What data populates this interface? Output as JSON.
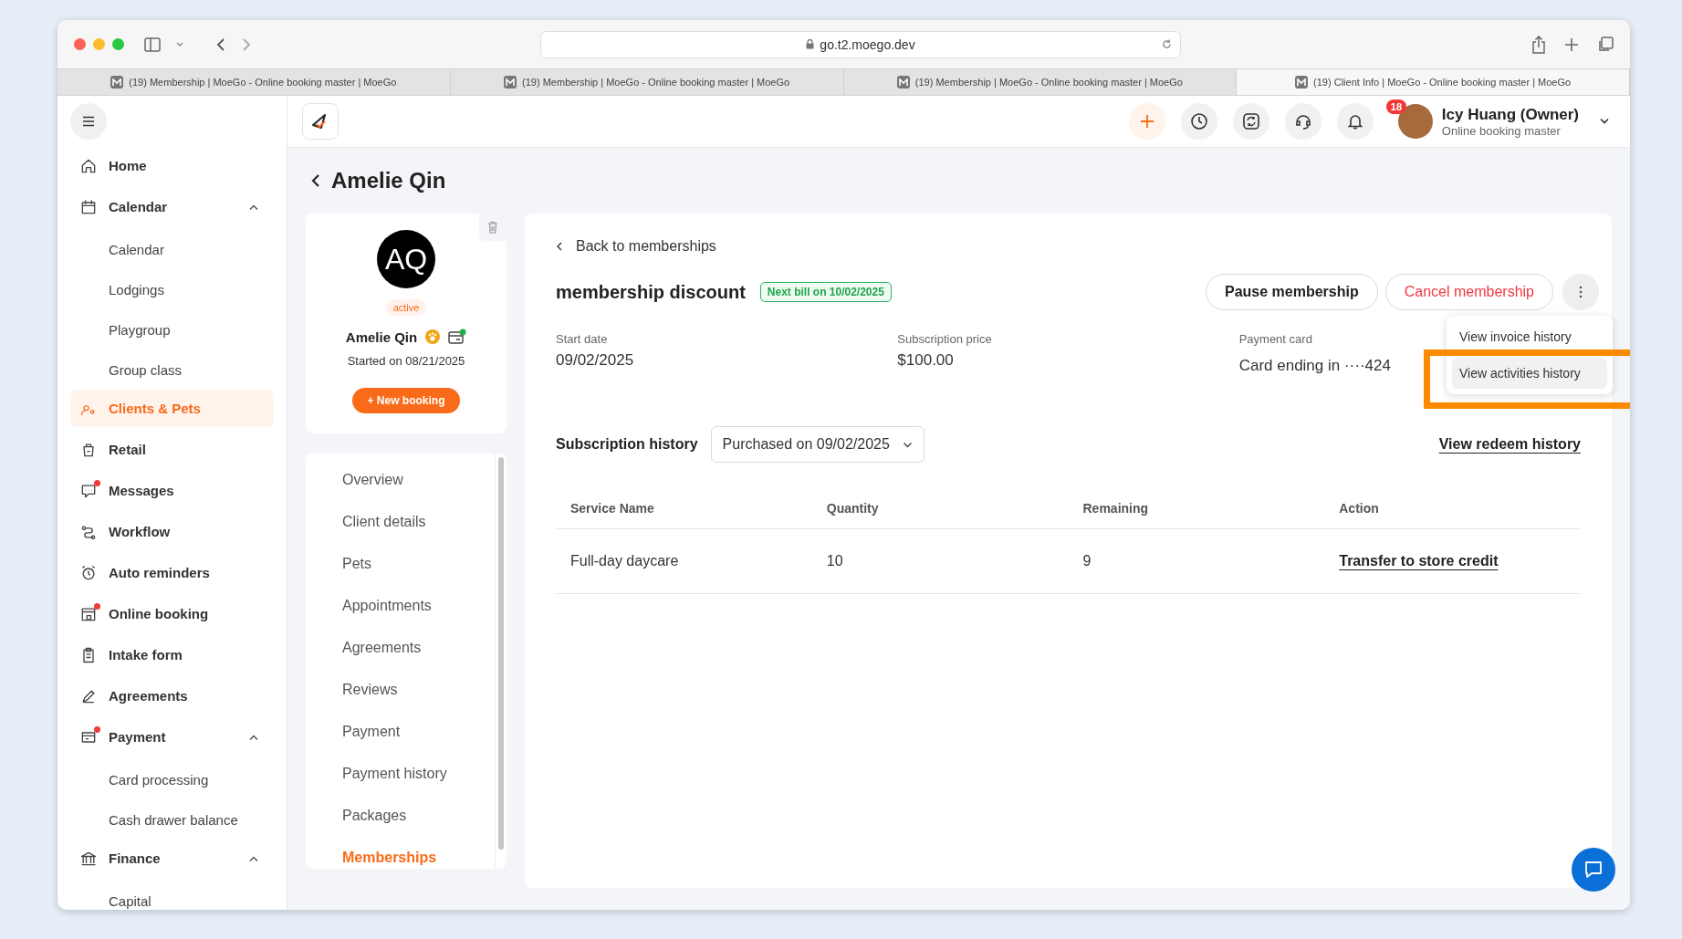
{
  "browser": {
    "url": "go.t2.moego.dev",
    "tabs": [
      {
        "title": "(19) Membership | MoeGo - Online booking master | MoeGo",
        "selected": false
      },
      {
        "title": "(19) Membership | MoeGo - Online booking master | MoeGo",
        "selected": false
      },
      {
        "title": "(19) Membership | MoeGo - Online booking master | MoeGo",
        "selected": false
      },
      {
        "title": "(19) Client Info | MoeGo - Online booking master | MoeGo",
        "selected": true
      }
    ]
  },
  "sidebar": {
    "items": [
      {
        "label": "Home",
        "selected": false,
        "notification": false
      },
      {
        "label": "Calendar",
        "selected": false,
        "notification": false,
        "expanded": true,
        "children": [
          {
            "label": "Calendar",
            "selected": false
          },
          {
            "label": "Lodgings",
            "selected": false
          },
          {
            "label": "Playgroup",
            "selected": false
          },
          {
            "label": "Group class",
            "selected": false
          }
        ]
      },
      {
        "label": "Clients & Pets",
        "selected": true,
        "notification": false
      },
      {
        "label": "Retail",
        "selected": false,
        "notification": false
      },
      {
        "label": "Messages",
        "selected": false,
        "notification": true
      },
      {
        "label": "Workflow",
        "selected": false,
        "notification": false
      },
      {
        "label": "Auto reminders",
        "selected": false,
        "notification": false
      },
      {
        "label": "Online booking",
        "selected": false,
        "notification": true
      },
      {
        "label": "Intake form",
        "selected": false,
        "notification": false
      },
      {
        "label": "Agreements",
        "selected": false,
        "notification": false
      },
      {
        "label": "Payment",
        "selected": false,
        "notification": true,
        "expanded": true,
        "children": [
          {
            "label": "Card processing",
            "selected": false
          },
          {
            "label": "Cash drawer balance",
            "selected": false
          }
        ]
      },
      {
        "label": "Finance",
        "selected": false,
        "notification": false,
        "expanded": true,
        "children": [
          {
            "label": "Capital",
            "selected": false
          }
        ]
      }
    ]
  },
  "header": {
    "notification_count": "18",
    "user": {
      "name": "Icy Huang (Owner)",
      "business": "Online booking master"
    }
  },
  "client": {
    "title": "Amelie Qin",
    "initials": "AQ",
    "status": "active",
    "name": "Amelie Qin",
    "started": "Started on 08/21/2025",
    "new_booking": "+ New booking"
  },
  "client_nav": [
    {
      "label": "Overview",
      "selected": false
    },
    {
      "label": "Client details",
      "selected": false
    },
    {
      "label": "Pets",
      "selected": false
    },
    {
      "label": "Appointments",
      "selected": false
    },
    {
      "label": "Agreements",
      "selected": false
    },
    {
      "label": "Reviews",
      "selected": false
    },
    {
      "label": "Payment",
      "selected": false
    },
    {
      "label": "Payment history",
      "selected": false
    },
    {
      "label": "Packages",
      "selected": false
    },
    {
      "label": "Memberships",
      "selected": true
    }
  ],
  "membership": {
    "back": "Back to memberships",
    "name": "membership discount",
    "next_bill": "Next bill on 10/02/2025",
    "actions": [
      {
        "label": "Pause membership",
        "kind": "default"
      },
      {
        "label": "Cancel membership",
        "kind": "danger"
      }
    ],
    "menu": [
      {
        "label": "View invoice history",
        "selected": false
      },
      {
        "label": "View activities history",
        "selected": true
      }
    ],
    "fields": [
      {
        "label": "Start date",
        "value": "09/02/2025"
      },
      {
        "label": "Subscription price",
        "value": "$100.00"
      },
      {
        "label": "Payment card",
        "value": "Card ending in ····424"
      }
    ],
    "history": {
      "label": "Subscription history",
      "purchase": "Purchased on 09/02/2025",
      "redeem": "View redeem history"
    },
    "table": {
      "columns": [
        "Service Name",
        "Quantity",
        "Remaining",
        "Action"
      ],
      "rows": [
        [
          "Full-day daycare",
          "10",
          "9",
          "Transfer to store credit"
        ]
      ]
    }
  }
}
